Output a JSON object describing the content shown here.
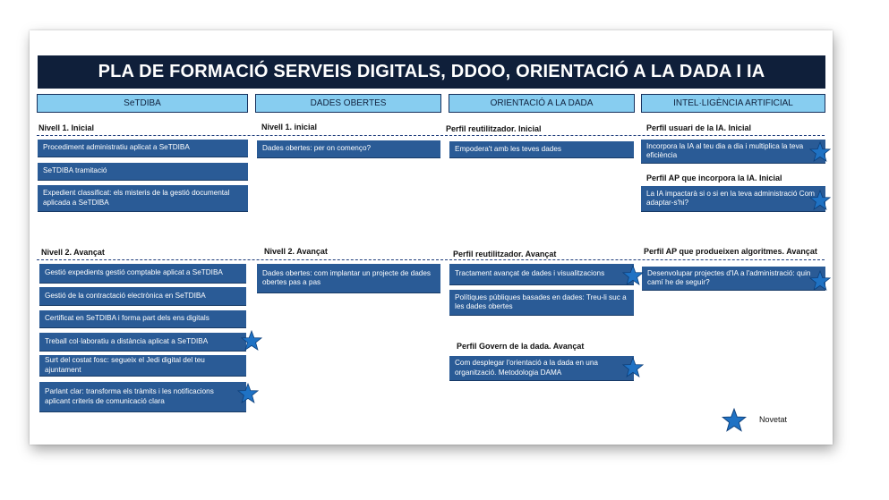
{
  "title": "PLA DE FORMACIÓ SERVEIS DIGITALS, DDOO, ORIENTACIÓ A LA DADA I IA",
  "columns": [
    {
      "header": "SeTDIBA",
      "sections": [
        {
          "title": "Nivell 1. Inicial",
          "items": [
            "Procediment administratiu aplicat a SeTDIBA",
            "SeTDIBA tramitació",
            "Expedient classificat: els misteris de la gestió documental aplicada a SeTDIBA"
          ]
        },
        {
          "title": "Nivell 2. Avançat",
          "items": [
            "Gestió expedients gestió comptable aplicat a SeTDIBA",
            "Gestió de la contractació electrònica en SeTDIBA",
            "Certificat en SeTDIBA i forma part dels ens digitals",
            "Treball col·laboratiu a distància aplicat a SeTDIBA",
            "Surt del costat fosc: segueix el Jedi digital del teu ajuntament",
            "Parlant clar: transforma els tràmits i les notificacions aplicant criteris de comunicació clara"
          ]
        }
      ]
    },
    {
      "header": "DADES OBERTES",
      "sections": [
        {
          "title": "Nivell 1. inicial",
          "items": [
            "Dades obertes: per on començo?"
          ]
        },
        {
          "title": "Nivell 2. Avançat",
          "items": [
            "Dades obertes: com implantar un projecte de dades obertes pas a pas"
          ]
        }
      ]
    },
    {
      "header": "ORIENTACIÓ A LA DADA",
      "sections": [
        {
          "title": "Perfil reutilitzador. Inicial",
          "items": [
            "Empodera't amb les teves dades"
          ]
        },
        {
          "title": "Perfil reutilitzador. Avançat",
          "items": [
            "Tractament avançat de dades i visualitzacions",
            "Polítiques públiques basades en dades: Treu-li suc a les dades obertes"
          ]
        },
        {
          "title": "Perfil Govern de la dada. Avançat",
          "items": [
            "Com desplegar l'orientació a la dada en una organització. Metodologia DAMA"
          ]
        }
      ]
    },
    {
      "header": "INTEL·LIGÈNCIA ARTIFICIAL",
      "sections": [
        {
          "title": "Perfil usuari de la IA. Inicial",
          "items": [
            "Incorpora la IA al teu dia a dia i multiplica la teva eficiència"
          ]
        },
        {
          "title": "Perfil AP que incorpora la IA. Inicial",
          "items": [
            "La IA impactarà si o si en la teva administració Com adaptar-s'hi?"
          ]
        },
        {
          "title": "Perfil AP que produeixen algoritmes. Avançat",
          "items": [
            "Desenvolupar projectes d'IA a l'administració: quin camí he de seguir?"
          ]
        }
      ]
    }
  ],
  "legend": {
    "label": "Novetat",
    "icon": "star-icon"
  },
  "colors": {
    "title_bg": "#0f1f3a",
    "header_bg": "#87cdf0",
    "card_bg": "#2a5b96",
    "star": "#1f72c4"
  }
}
